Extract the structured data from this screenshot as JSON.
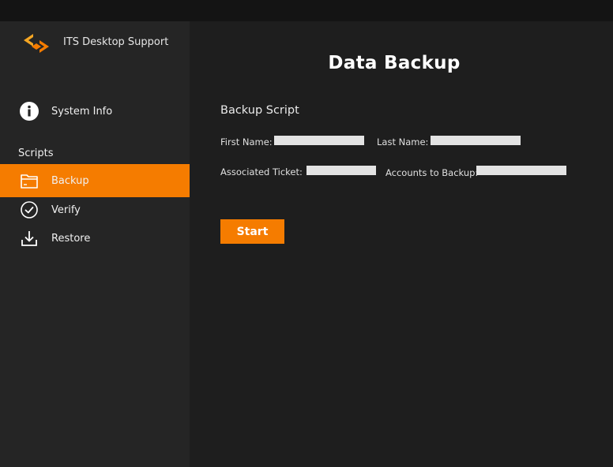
{
  "app": {
    "title": "ITS Desktop Support",
    "accent_color": "#f57c00",
    "logo_icon": "code-brackets-logo"
  },
  "sidebar": {
    "system_info": {
      "label": "System Info",
      "icon": "info-icon"
    },
    "section_label": "Scripts",
    "items": [
      {
        "label": "Backup",
        "icon": "folder-icon",
        "active": true
      },
      {
        "label": "Verify",
        "icon": "check-circle-icon",
        "active": false
      },
      {
        "label": "Restore",
        "icon": "download-icon",
        "active": false
      }
    ]
  },
  "main": {
    "title": "Data Backup",
    "form": {
      "title": "Backup Script",
      "first_name": {
        "label": "First Name:",
        "value": ""
      },
      "last_name": {
        "label": "Last Name:",
        "value": ""
      },
      "ticket": {
        "label": "Associated Ticket:",
        "value": ""
      },
      "accounts": {
        "label": "Accounts to Backup:",
        "value": ""
      }
    },
    "start_button": "Start"
  }
}
